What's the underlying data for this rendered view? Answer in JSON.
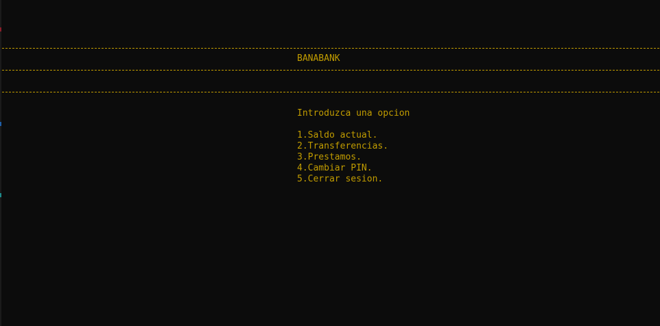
{
  "window": {
    "background_color": "#0c0c0c",
    "text_color": "#c19c00"
  },
  "header": {
    "title": "BANABANK"
  },
  "prompt": {
    "text": "Introduzca una opcion"
  },
  "menu": {
    "options": [
      {
        "label": "1.Saldo actual."
      },
      {
        "label": "2.Transferencias."
      },
      {
        "label": "3.Prestamos."
      },
      {
        "label": "4.Cambiar PIN."
      },
      {
        "label": "5.Cerrar sesion."
      }
    ]
  }
}
